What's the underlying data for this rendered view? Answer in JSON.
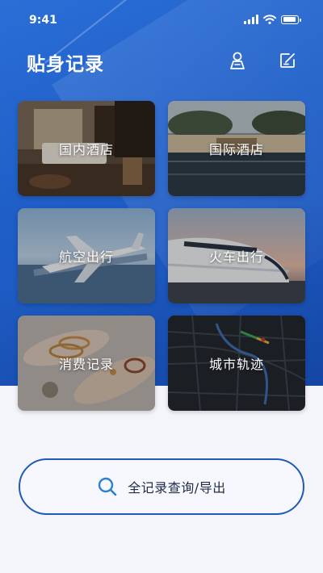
{
  "status_bar": {
    "time": "9:41"
  },
  "header": {
    "title": "贴身记录",
    "user_icon": "user-location-icon",
    "edit_icon": "edit-note-icon"
  },
  "categories": [
    {
      "label": "国内酒店",
      "image": "hotel-room-photo"
    },
    {
      "label": "国际酒店",
      "image": "resort-pool-photo"
    },
    {
      "label": "航空出行",
      "image": "airplane-photo"
    },
    {
      "label": "火车出行",
      "image": "bullet-train-photo"
    },
    {
      "label": "消费记录",
      "image": "jewelry-photo"
    },
    {
      "label": "城市轨迹",
      "image": "city-map-photo"
    }
  ],
  "search": {
    "label": "全记录查询/导出",
    "icon": "search-icon"
  },
  "colors": {
    "primary": "#1f5fc8",
    "button_border": "#2159b8",
    "background": "#f4f5fb"
  }
}
